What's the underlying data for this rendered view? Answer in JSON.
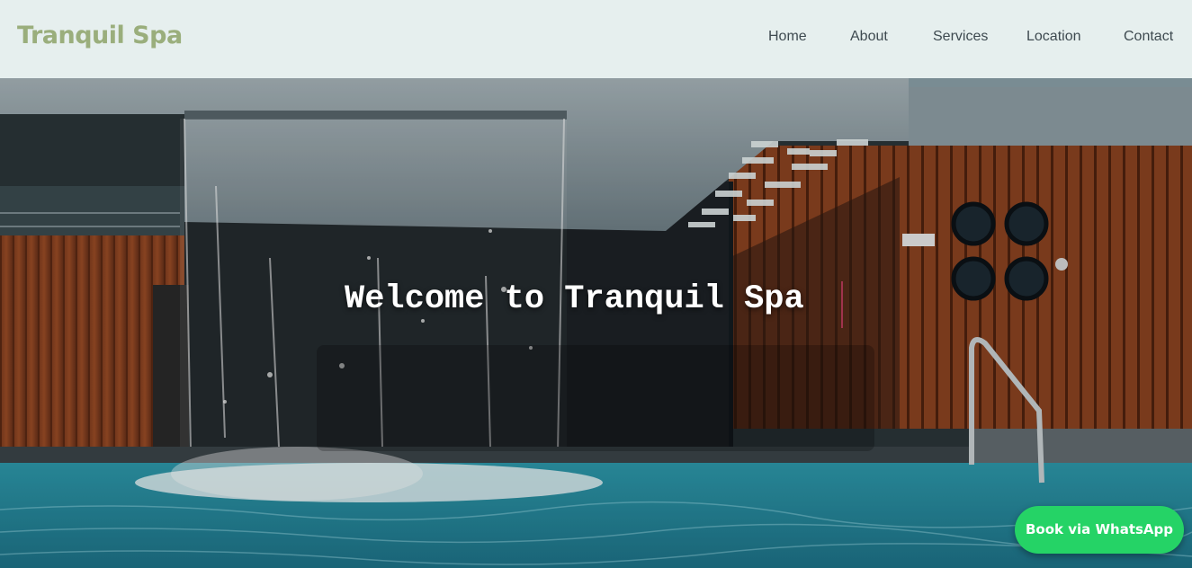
{
  "brand": {
    "name": "Tranquil Spa"
  },
  "nav": {
    "items": [
      {
        "label": "Home"
      },
      {
        "label": "About"
      },
      {
        "label": "Services"
      },
      {
        "label": "Location"
      },
      {
        "label": "Contact"
      }
    ]
  },
  "hero": {
    "heading": "Welcome to Tranquil Spa",
    "image_description_icon": "spa-pool-waterfall-photo"
  },
  "cta": {
    "whatsapp_label": "Book via WhatsApp"
  },
  "colors": {
    "header_bg": "#e6efee",
    "brand": "#9aae7c",
    "nav_text": "#3e4a50",
    "whatsapp": "#25d366",
    "cursor": "#a0334d"
  }
}
